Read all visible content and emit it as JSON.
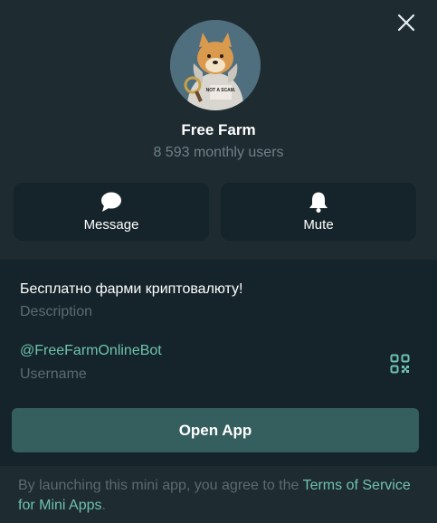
{
  "header": {
    "close_icon": "close-icon",
    "bot_name": "Free Farm",
    "monthly_users": "8 593 monthly users",
    "avatar_text": "NOT A SCAM."
  },
  "actions": {
    "message_label": "Message",
    "message_icon": "chat-bubble-icon",
    "mute_label": "Mute",
    "mute_icon": "bell-icon"
  },
  "info": {
    "description": "Бесплатно фарми криптовалюту!",
    "description_label": "Description",
    "username": "@FreeFarmOnlineBot",
    "username_label": "Username",
    "qr_icon": "qr-code-icon"
  },
  "open_app": {
    "label": "Open App"
  },
  "footer": {
    "text": "By launching this mini app, you agree to the ",
    "link_text": "Terms of Service for Mini Apps",
    "end": "."
  },
  "colors": {
    "background": "#1e2b30",
    "panel": "#15242a",
    "accent": "#6fc2b0",
    "button": "#355e5f",
    "muted": "#5b6b72"
  }
}
